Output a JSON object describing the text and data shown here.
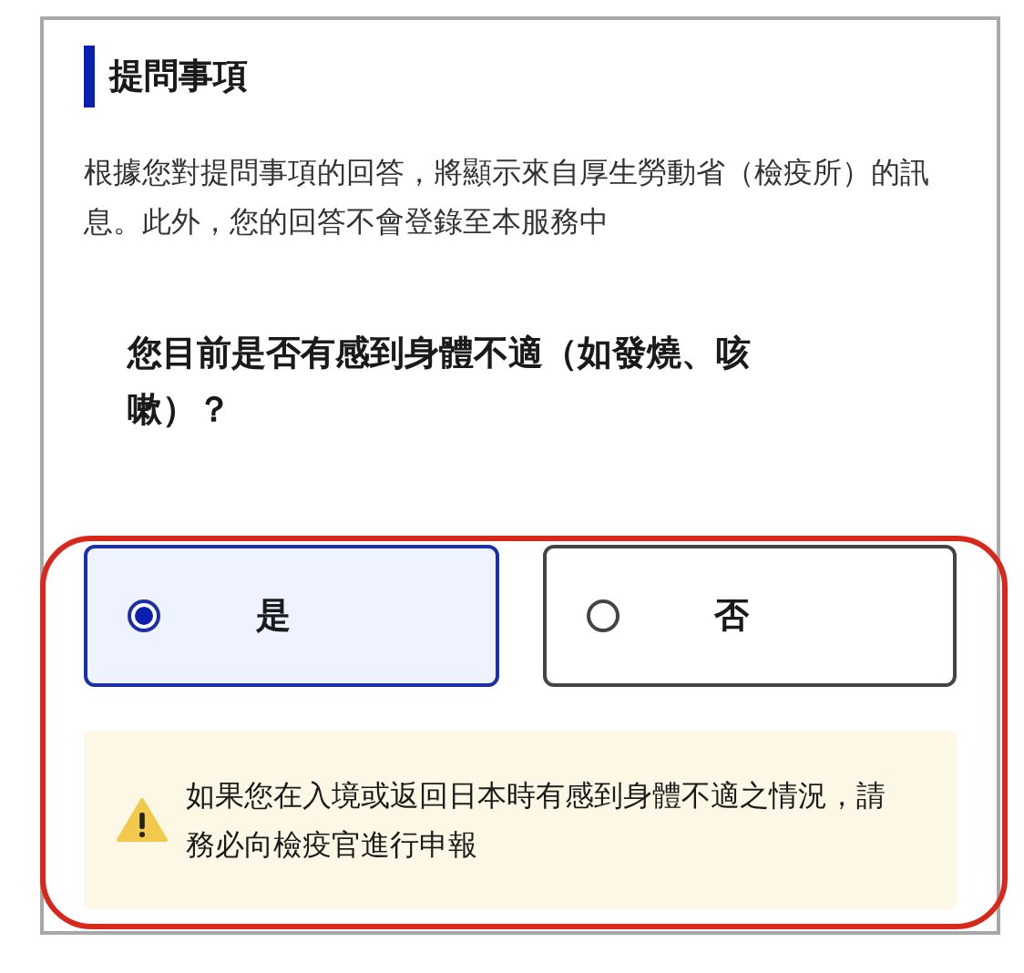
{
  "section": {
    "title": "提問事項",
    "description": "根據您對提問事項的回答，將顯示來自厚生勞動省（檢疫所）的訊息。此外，您的回答不會登錄至本服務中"
  },
  "question": {
    "text": "您目前是否有感到身體不適（如發燒、咳嗽）？",
    "options": [
      {
        "label": "是",
        "selected": true
      },
      {
        "label": "否",
        "selected": false
      }
    ]
  },
  "warning": {
    "text": "如果您在入境或返回日本時有感到身體不適之情況，請務必向檢疫官進行申報"
  }
}
